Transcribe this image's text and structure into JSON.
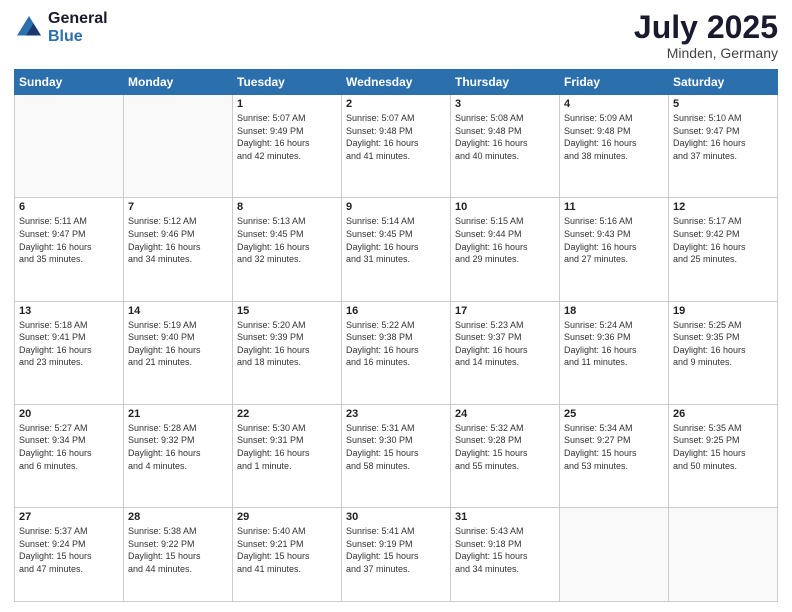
{
  "logo": {
    "line1": "General",
    "line2": "Blue"
  },
  "title": "July 2025",
  "location": "Minden, Germany",
  "weekdays": [
    "Sunday",
    "Monday",
    "Tuesday",
    "Wednesday",
    "Thursday",
    "Friday",
    "Saturday"
  ],
  "weeks": [
    [
      {
        "day": "",
        "info": ""
      },
      {
        "day": "",
        "info": ""
      },
      {
        "day": "1",
        "info": "Sunrise: 5:07 AM\nSunset: 9:49 PM\nDaylight: 16 hours\nand 42 minutes."
      },
      {
        "day": "2",
        "info": "Sunrise: 5:07 AM\nSunset: 9:48 PM\nDaylight: 16 hours\nand 41 minutes."
      },
      {
        "day": "3",
        "info": "Sunrise: 5:08 AM\nSunset: 9:48 PM\nDaylight: 16 hours\nand 40 minutes."
      },
      {
        "day": "4",
        "info": "Sunrise: 5:09 AM\nSunset: 9:48 PM\nDaylight: 16 hours\nand 38 minutes."
      },
      {
        "day": "5",
        "info": "Sunrise: 5:10 AM\nSunset: 9:47 PM\nDaylight: 16 hours\nand 37 minutes."
      }
    ],
    [
      {
        "day": "6",
        "info": "Sunrise: 5:11 AM\nSunset: 9:47 PM\nDaylight: 16 hours\nand 35 minutes."
      },
      {
        "day": "7",
        "info": "Sunrise: 5:12 AM\nSunset: 9:46 PM\nDaylight: 16 hours\nand 34 minutes."
      },
      {
        "day": "8",
        "info": "Sunrise: 5:13 AM\nSunset: 9:45 PM\nDaylight: 16 hours\nand 32 minutes."
      },
      {
        "day": "9",
        "info": "Sunrise: 5:14 AM\nSunset: 9:45 PM\nDaylight: 16 hours\nand 31 minutes."
      },
      {
        "day": "10",
        "info": "Sunrise: 5:15 AM\nSunset: 9:44 PM\nDaylight: 16 hours\nand 29 minutes."
      },
      {
        "day": "11",
        "info": "Sunrise: 5:16 AM\nSunset: 9:43 PM\nDaylight: 16 hours\nand 27 minutes."
      },
      {
        "day": "12",
        "info": "Sunrise: 5:17 AM\nSunset: 9:42 PM\nDaylight: 16 hours\nand 25 minutes."
      }
    ],
    [
      {
        "day": "13",
        "info": "Sunrise: 5:18 AM\nSunset: 9:41 PM\nDaylight: 16 hours\nand 23 minutes."
      },
      {
        "day": "14",
        "info": "Sunrise: 5:19 AM\nSunset: 9:40 PM\nDaylight: 16 hours\nand 21 minutes."
      },
      {
        "day": "15",
        "info": "Sunrise: 5:20 AM\nSunset: 9:39 PM\nDaylight: 16 hours\nand 18 minutes."
      },
      {
        "day": "16",
        "info": "Sunrise: 5:22 AM\nSunset: 9:38 PM\nDaylight: 16 hours\nand 16 minutes."
      },
      {
        "day": "17",
        "info": "Sunrise: 5:23 AM\nSunset: 9:37 PM\nDaylight: 16 hours\nand 14 minutes."
      },
      {
        "day": "18",
        "info": "Sunrise: 5:24 AM\nSunset: 9:36 PM\nDaylight: 16 hours\nand 11 minutes."
      },
      {
        "day": "19",
        "info": "Sunrise: 5:25 AM\nSunset: 9:35 PM\nDaylight: 16 hours\nand 9 minutes."
      }
    ],
    [
      {
        "day": "20",
        "info": "Sunrise: 5:27 AM\nSunset: 9:34 PM\nDaylight: 16 hours\nand 6 minutes."
      },
      {
        "day": "21",
        "info": "Sunrise: 5:28 AM\nSunset: 9:32 PM\nDaylight: 16 hours\nand 4 minutes."
      },
      {
        "day": "22",
        "info": "Sunrise: 5:30 AM\nSunset: 9:31 PM\nDaylight: 16 hours\nand 1 minute."
      },
      {
        "day": "23",
        "info": "Sunrise: 5:31 AM\nSunset: 9:30 PM\nDaylight: 15 hours\nand 58 minutes."
      },
      {
        "day": "24",
        "info": "Sunrise: 5:32 AM\nSunset: 9:28 PM\nDaylight: 15 hours\nand 55 minutes."
      },
      {
        "day": "25",
        "info": "Sunrise: 5:34 AM\nSunset: 9:27 PM\nDaylight: 15 hours\nand 53 minutes."
      },
      {
        "day": "26",
        "info": "Sunrise: 5:35 AM\nSunset: 9:25 PM\nDaylight: 15 hours\nand 50 minutes."
      }
    ],
    [
      {
        "day": "27",
        "info": "Sunrise: 5:37 AM\nSunset: 9:24 PM\nDaylight: 15 hours\nand 47 minutes."
      },
      {
        "day": "28",
        "info": "Sunrise: 5:38 AM\nSunset: 9:22 PM\nDaylight: 15 hours\nand 44 minutes."
      },
      {
        "day": "29",
        "info": "Sunrise: 5:40 AM\nSunset: 9:21 PM\nDaylight: 15 hours\nand 41 minutes."
      },
      {
        "day": "30",
        "info": "Sunrise: 5:41 AM\nSunset: 9:19 PM\nDaylight: 15 hours\nand 37 minutes."
      },
      {
        "day": "31",
        "info": "Sunrise: 5:43 AM\nSunset: 9:18 PM\nDaylight: 15 hours\nand 34 minutes."
      },
      {
        "day": "",
        "info": ""
      },
      {
        "day": "",
        "info": ""
      }
    ]
  ]
}
